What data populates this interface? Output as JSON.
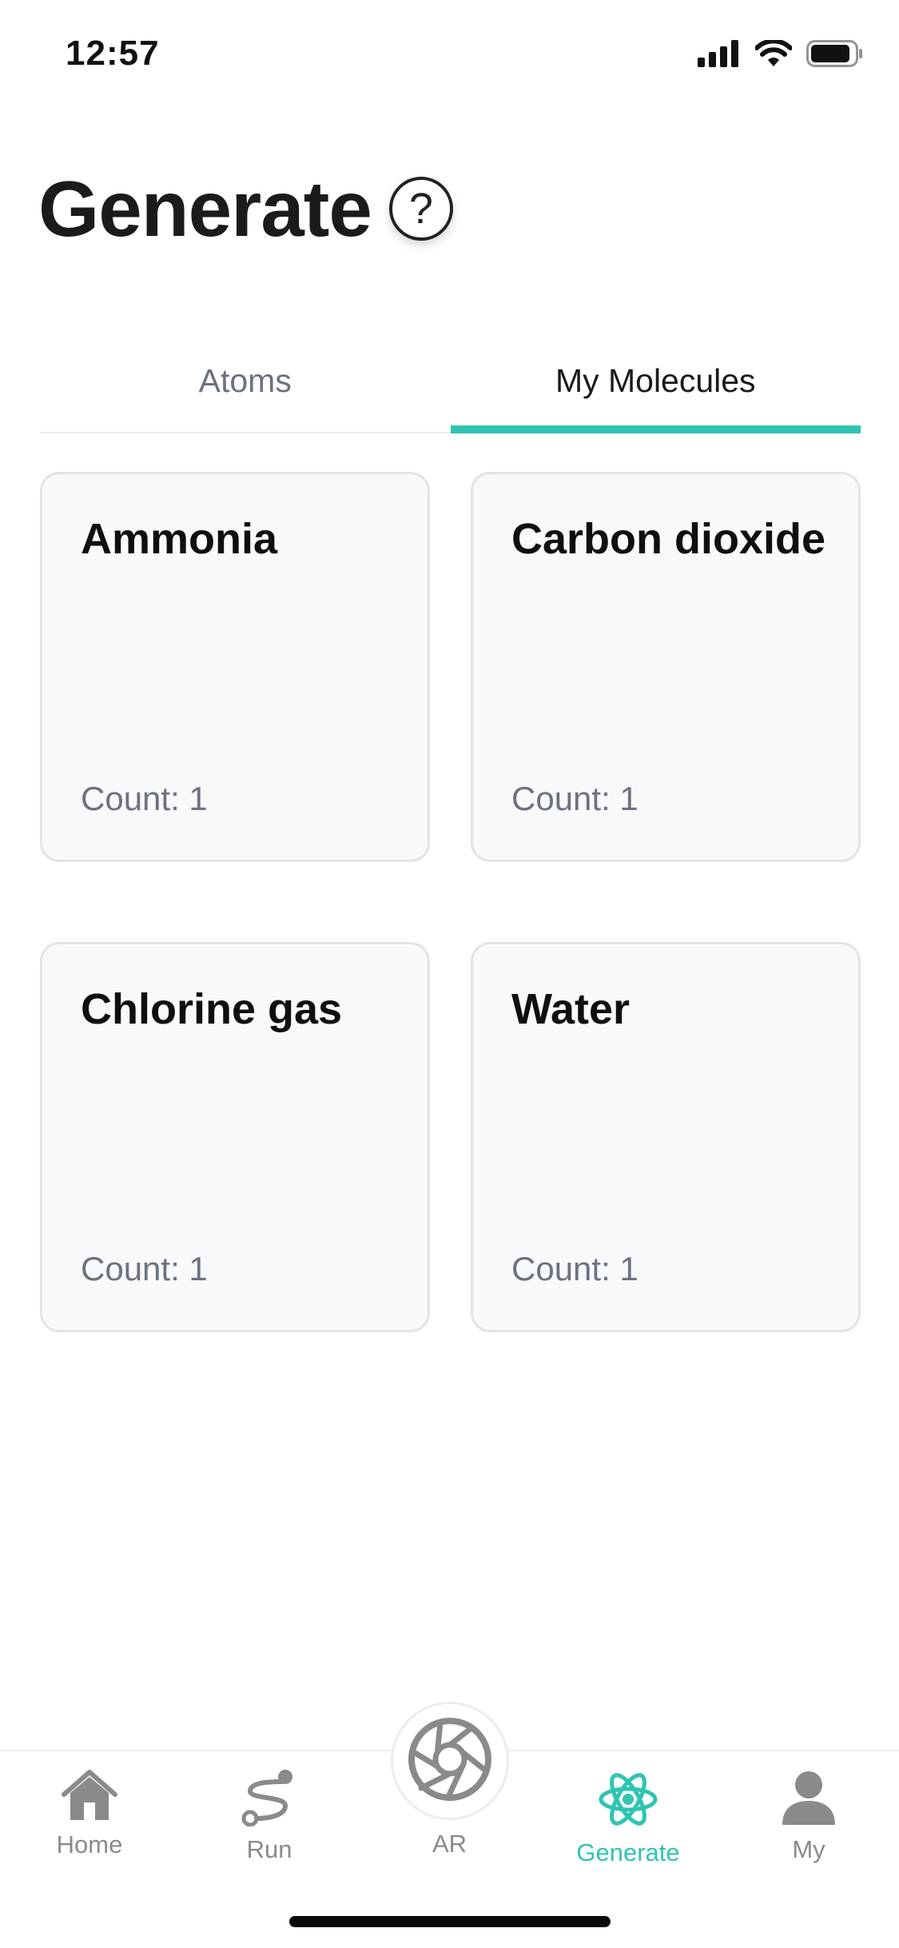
{
  "status_bar": {
    "time": "12:57"
  },
  "header": {
    "title": "Generate",
    "help_symbol": "?"
  },
  "tabs": [
    {
      "label": "Atoms",
      "active": false
    },
    {
      "label": "My Molecules",
      "active": true
    }
  ],
  "molecules": [
    {
      "name": "Ammonia",
      "count": "Count: 1"
    },
    {
      "name": "Carbon dioxide",
      "count": "Count: 1"
    },
    {
      "name": "Chlorine gas",
      "count": "Count: 1"
    },
    {
      "name": "Water",
      "count": "Count: 1"
    }
  ],
  "bottom_nav": {
    "items": [
      {
        "label": "Home",
        "icon": "home-icon"
      },
      {
        "label": "Run",
        "icon": "route-icon"
      },
      {
        "label": "AR",
        "icon": "camera-aperture-icon"
      },
      {
        "label": "Generate",
        "icon": "atom-icon",
        "active": true
      },
      {
        "label": "My",
        "icon": "person-icon"
      }
    ]
  },
  "colors": {
    "accent": "#2fc4b2",
    "inactive_text": "#6b7280",
    "nav_inactive": "#8a8a8a",
    "card_bg": "#f8f9fb",
    "card_border": "#e3e4e8"
  }
}
